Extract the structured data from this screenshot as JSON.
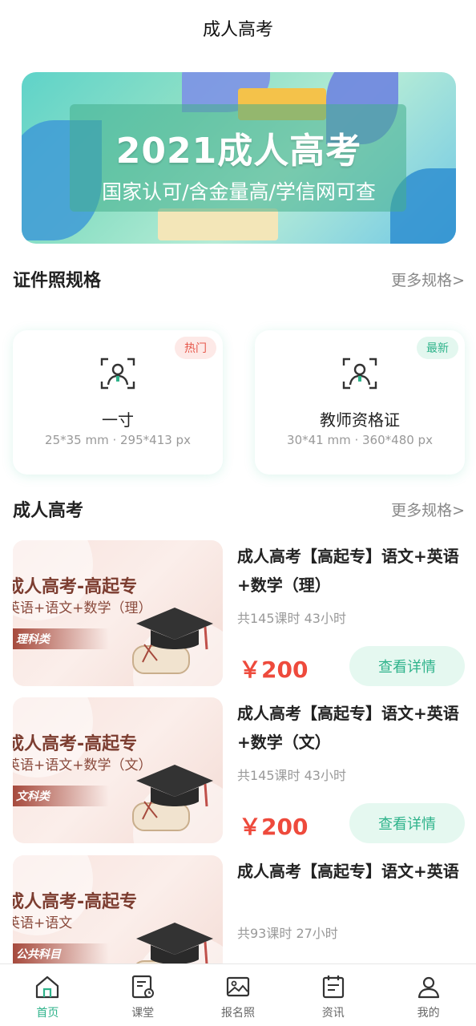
{
  "header": {
    "title": "成人高考"
  },
  "banner": {
    "headline": "2021成人高考",
    "subline": "国家认可/含金量高/学信网可查"
  },
  "spec_section": {
    "title": "证件照规格",
    "more": "更多规格>",
    "cards": [
      {
        "tag": "热门",
        "name": "一寸",
        "dims": "25*35 mm  ·  295*413 px",
        "icon": "portrait-scan-icon"
      },
      {
        "tag": "最新",
        "name": "教师资格证",
        "dims": "30*41 mm  ·  360*480 px",
        "icon": "portrait-scan-icon"
      }
    ]
  },
  "course_section": {
    "title": "成人高考",
    "more": "更多规格>",
    "courses": [
      {
        "thumb_title": "成人高考-高起专",
        "thumb_sub": "英语+语文+数学（理）",
        "thumb_tag": "理科类",
        "title": "成人高考【高起专】语文+英语+数学（理）",
        "lessons": "共145课时 43小时",
        "price": "￥200",
        "button": "查看详情"
      },
      {
        "thumb_title": "成人高考-高起专",
        "thumb_sub": "英语+语文+数学（文）",
        "thumb_tag": "文科类",
        "title": "成人高考【高起专】语文+英语+数学（文）",
        "lessons": "共145课时 43小时",
        "price": "￥200",
        "button": "查看详情"
      },
      {
        "thumb_title": "成人高考-高起专",
        "thumb_sub": "英语+语文",
        "thumb_tag": "公共科目",
        "title": "成人高考【高起专】语文+英语",
        "lessons": "共93课时 27小时",
        "price": "",
        "button": ""
      }
    ]
  },
  "tabbar": {
    "items": [
      {
        "label": "首页",
        "icon": "home-icon",
        "active": true
      },
      {
        "label": "课堂",
        "icon": "classroom-icon",
        "active": false
      },
      {
        "label": "报名照",
        "icon": "photo-icon",
        "active": false
      },
      {
        "label": "资讯",
        "icon": "news-icon",
        "active": false
      },
      {
        "label": "我的",
        "icon": "profile-icon",
        "active": false
      }
    ]
  },
  "colors": {
    "accent": "#2fb38b",
    "price": "#ee4a3c",
    "hot_tag": "#e6574a"
  }
}
